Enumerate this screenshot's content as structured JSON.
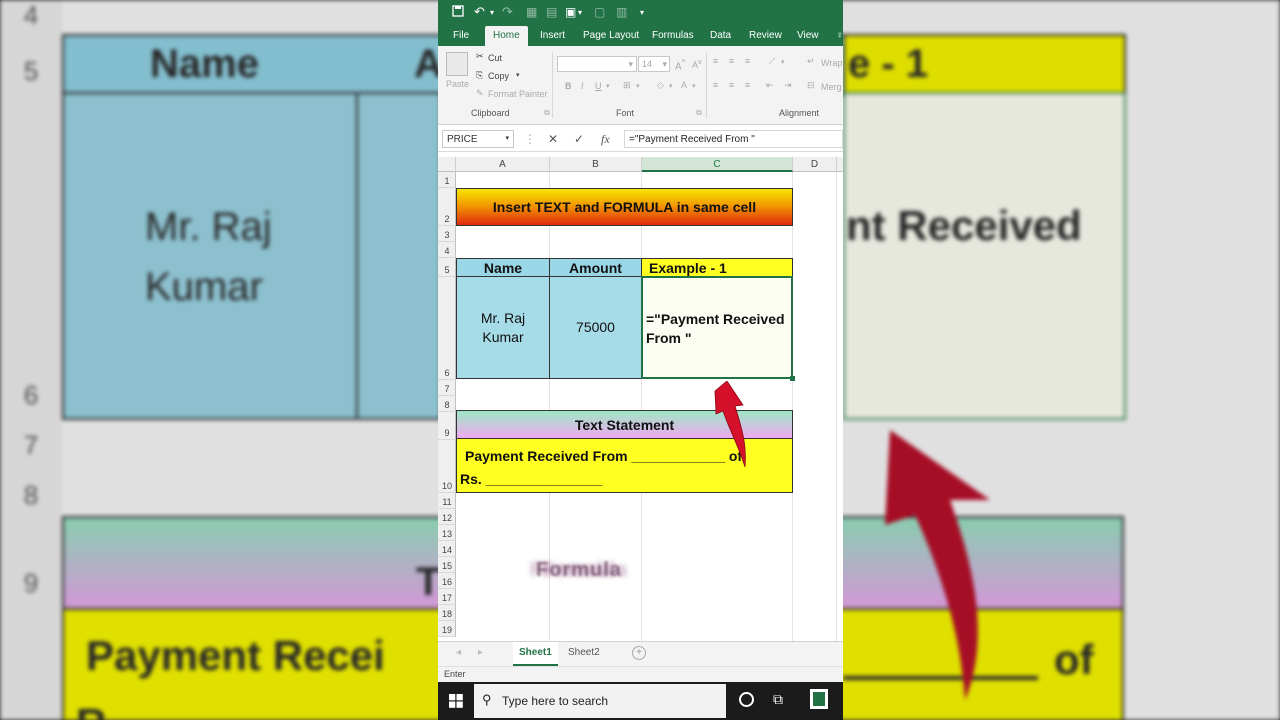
{
  "background": {
    "row_numbers": [
      "4",
      "5",
      "6",
      "7",
      "8",
      "9"
    ],
    "header_name": "Name",
    "header_amount_partial": "A",
    "header_example_partial": "e - 1",
    "name_line1": "Mr. Raj",
    "name_line2": "Kumar",
    "formula_partial": "nt Received",
    "text_statement_partial": "T",
    "payment_partial": "Payment Recei",
    "of_word": "of",
    "rs_partial": "R"
  },
  "qat": {
    "save_icon": "save-icon",
    "undo_icon": "undo-icon",
    "redo_icon": "redo-icon"
  },
  "tabs": {
    "file": "File",
    "home": "Home",
    "insert": "Insert",
    "page_layout": "Page Layout",
    "formulas": "Formulas",
    "data": "Data",
    "review": "Review",
    "view": "View"
  },
  "ribbon": {
    "paste": "Paste",
    "cut": "Cut",
    "copy": "Copy",
    "format_painter": "Format Painter",
    "clipboard": "Clipboard",
    "font_size": "14",
    "bold": "B",
    "italic": "I",
    "underline": "U",
    "font_group": "Font",
    "wrap": "Wrap",
    "merge": "Merg",
    "alignment_group": "Alignment"
  },
  "formula_bar": {
    "name_box": "PRICE",
    "cancel": "✕",
    "enter": "✓",
    "fx": "fx",
    "formula": "=\"Payment Received From \""
  },
  "columns": [
    "A",
    "B",
    "C",
    "D"
  ],
  "rows": [
    "1",
    "2",
    "3",
    "4",
    "5",
    "6",
    "7",
    "8",
    "9",
    "10",
    "11",
    "12",
    "13",
    "14",
    "15",
    "16",
    "17",
    "18",
    "19"
  ],
  "cells": {
    "title": "Insert TEXT and FORMULA in same cell",
    "header_name": "Name",
    "header_amount": "Amount",
    "header_example": "Example - 1",
    "name_line1": "Mr. Raj",
    "name_line2": "Kumar",
    "amount": "75000",
    "formula_line1": "=\"Payment Received",
    "formula_line2": "From \"",
    "text_statement": "Text Statement",
    "statement_line1": "Payment Received From ____________ of",
    "statement_line2": "Rs. _______________"
  },
  "watermark": "Formula",
  "sheets": [
    "Sheet1",
    "Sheet2"
  ],
  "status": "Enter",
  "taskbar": {
    "search_placeholder": "Type here to search"
  },
  "colors": {
    "excel_green": "#217346",
    "header_blue": "#99d7e6",
    "highlight_yellow": "#ffff22",
    "arrow_red": "#d4102a"
  }
}
